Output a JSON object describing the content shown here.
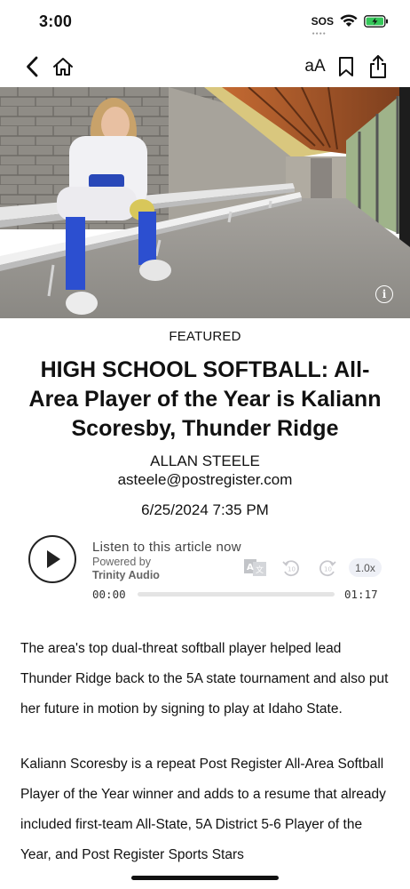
{
  "status_bar": {
    "time": "3:00",
    "sos": "SOS"
  },
  "nav": {
    "font_label": "aA"
  },
  "hero": {
    "description": "photo-softball-player-in-dugout"
  },
  "article": {
    "kicker": "FEATURED",
    "headline": "HIGH SCHOOL SOFTBALL: All-Area Player of the Year is Kaliann Scoresby, Thunder Ridge",
    "author": "ALLAN STEELE",
    "email": "asteele@postregister.com",
    "datetime": "6/25/2024 7:35 PM",
    "paragraphs": [
      "The area's top dual-threat softball player helped lead Thunder Ridge back to the 5A state tournament and also put her future in motion by signing to play at Idaho State.",
      "Kaliann Scoresby is a repeat Post Register All-Area Softball Player of the Year winner and adds to a resume that already included first-team All-State, 5A District 5-6 Player of the Year, and Post Register Sports Stars"
    ]
  },
  "audio_player": {
    "listen_label": "Listen to this article now",
    "powered_label": "Powered by",
    "provider": "Trinity Audio",
    "speed": "1.0x",
    "current_time": "00:00",
    "total_time": "01:17",
    "progress": 0.0
  },
  "colors": {
    "text": "#111111",
    "speed_bg": "#eef0f6",
    "progress_track": "#e4e4e4"
  },
  "icons": [
    "back-icon",
    "home-icon",
    "bookmark-icon",
    "share-icon",
    "info-icon",
    "play-icon",
    "translate-icon",
    "rewind-10-icon",
    "forward-10-icon",
    "wifi-icon",
    "battery-icon"
  ]
}
